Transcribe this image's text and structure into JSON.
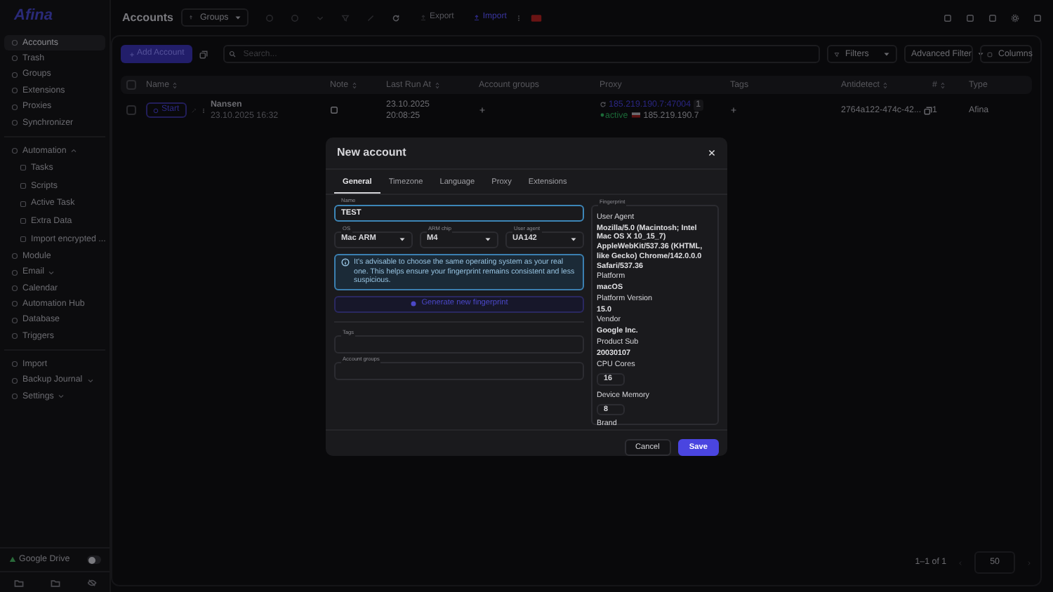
{
  "sidebar": {
    "logo": "Afina",
    "sections": [
      [
        {
          "label": "Accounts",
          "selected": true
        },
        {
          "label": "Trash",
          "selected": false
        },
        {
          "label": "Groups",
          "selected": false
        },
        {
          "label": "Extensions",
          "selected": false
        },
        {
          "label": "Proxies",
          "selected": false
        },
        {
          "label": "Synchronizer",
          "selected": false
        }
      ],
      [
        {
          "label": "Automation",
          "selected": false,
          "expanded": true,
          "children": [
            {
              "label": "Tasks",
              "selected": false
            },
            {
              "label": "Scripts",
              "selected": false
            },
            {
              "label": "Active Task",
              "selected": false
            },
            {
              "label": "Extra Data",
              "selected": false
            },
            {
              "label": "Import encrypted ...",
              "selected": false
            }
          ]
        },
        {
          "label": "Module",
          "selected": false
        },
        {
          "label": "Email",
          "selected": false,
          "expanded": false
        },
        {
          "label": "Calendar",
          "selected": false
        },
        {
          "label": "Automation Hub",
          "selected": false
        },
        {
          "label": "Database",
          "selected": false
        },
        {
          "label": "Triggers",
          "selected": false
        }
      ],
      [
        {
          "label": "Import",
          "selected": false
        },
        {
          "label": "Backup Journal",
          "selected": false,
          "expanded": false
        },
        {
          "label": "Settings",
          "selected": false,
          "expanded": false
        }
      ]
    ],
    "google_drive": {
      "label": "Google Drive",
      "on": false
    }
  },
  "header": {
    "title": "Accounts",
    "groups_select": "Groups",
    "toolbar": [
      {
        "kind": "icon",
        "disabled": true
      },
      {
        "kind": "icon",
        "disabled": true
      },
      {
        "kind": "icon",
        "disabled": true
      },
      {
        "kind": "icon",
        "disabled": true
      },
      {
        "kind": "icon",
        "disabled": true
      },
      {
        "kind": "icon",
        "disabled": false
      },
      {
        "kind": "button",
        "label": "Export",
        "disabled": true
      },
      {
        "kind": "button",
        "label": "Import",
        "disabled": false
      }
    ]
  },
  "actions": {
    "add_button": "Add Account",
    "search": {
      "placeholder": "Search..."
    },
    "filters": "Filters",
    "advanced_filter": "Advanced Filter",
    "columns": "Columns"
  },
  "table": {
    "select_all_checked": false,
    "columns": [
      {
        "label": "Name",
        "sortable": true
      },
      {
        "label": "Note",
        "sortable": true
      },
      {
        "label": "Last Run At",
        "sortable": true
      },
      {
        "label": "Account groups",
        "sortable": false
      },
      {
        "label": "Proxy",
        "sortable": false
      },
      {
        "label": "Tags",
        "sortable": false
      },
      {
        "label": "Antidetect",
        "sortable": true
      },
      {
        "label": "#",
        "sortable": true
      },
      {
        "label": "Type",
        "sortable": false
      }
    ],
    "rows": [
      {
        "checked": false,
        "start": "Start",
        "name": "Nansen",
        "created": "23.10.2025 16:32",
        "last_run_date": "23.10.2025",
        "last_run_time": "20:08:25",
        "proxy": "185.219.190.7:47004",
        "proxy_count": "1",
        "proxy_status": "active",
        "proxy_ip": "185.219.190.7",
        "antidetect": "2764a122-474c-42...",
        "number": "1",
        "type": "Afina"
      }
    ]
  },
  "pagination": {
    "range": "1–1 of 1",
    "per_page": "50"
  },
  "dialog": {
    "title": "New account",
    "tabs": [
      {
        "label": "General",
        "selected": true
      },
      {
        "label": "Timezone",
        "selected": false
      },
      {
        "label": "Language",
        "selected": false
      },
      {
        "label": "Proxy",
        "selected": false
      },
      {
        "label": "Extensions",
        "selected": false
      }
    ],
    "name": {
      "label": "Name",
      "value": "TEST"
    },
    "selects": [
      {
        "label": "OS",
        "value": "Mac ARM"
      },
      {
        "label": "ARM chip",
        "value": "M4"
      },
      {
        "label": "User agent",
        "value": "UA142"
      }
    ],
    "info": "It's advisable to choose the same operating system as your real one. This helps ensure your fingerprint remains consistent and less suspicious.",
    "generate_button": "Generate new fingerprint",
    "fields": [
      {
        "label": "Tags"
      },
      {
        "label": "Account groups"
      }
    ],
    "fingerprint": {
      "label": "Fingerprint",
      "entries": [
        {
          "kind": "text",
          "label": "User Agent",
          "value": "Mozilla/5.0 (Macintosh; Intel Mac OS X 10_15_7) AppleWebKit/537.36 (KHTML, like Gecko) Chrome/142.0.0.0 Safari/537.36"
        },
        {
          "kind": "text",
          "label": "Platform",
          "value": "macOS"
        },
        {
          "kind": "text",
          "label": "Platform Version",
          "value": "15.0"
        },
        {
          "kind": "text",
          "label": "Vendor",
          "value": "Google Inc."
        },
        {
          "kind": "text",
          "label": "Product Sub",
          "value": "20030107"
        },
        {
          "kind": "input",
          "label": "CPU Cores",
          "value": "16"
        },
        {
          "kind": "input",
          "label": "Device Memory",
          "value": "8"
        },
        {
          "kind": "text",
          "label": "Brand"
        }
      ]
    },
    "buttons": [
      {
        "kind": "secondary",
        "label": "Cancel"
      },
      {
        "kind": "primary",
        "label": "Save"
      }
    ]
  }
}
